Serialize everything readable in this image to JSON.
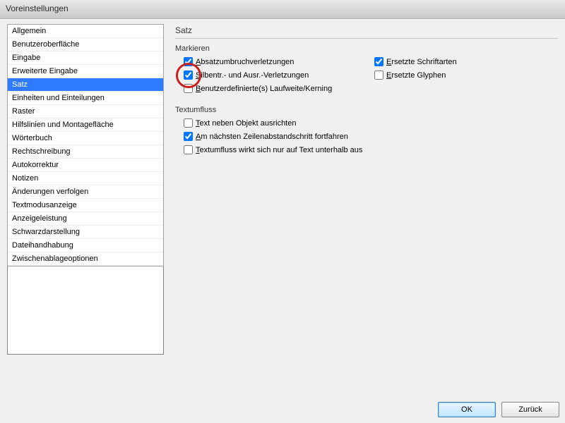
{
  "window": {
    "title": "Voreinstellungen"
  },
  "sidebar": {
    "items": [
      "Allgemein",
      "Benutzeroberfläche",
      "Eingabe",
      "Erweiterte Eingabe",
      "Satz",
      "Einheiten und Einteilungen",
      "Raster",
      "Hilfslinien und Montagefläche",
      "Wörterbuch",
      "Rechtschreibung",
      "Autokorrektur",
      "Notizen",
      "Änderungen verfolgen",
      "Textmodusanzeige",
      "Anzeigeleistung",
      "Schwarzdarstellung",
      "Dateihandhabung",
      "Zwischenablageoptionen"
    ],
    "selected_index": 4
  },
  "panel": {
    "title": "Satz",
    "groups": {
      "mark": {
        "title": "Markieren",
        "options": [
          {
            "label": "Absatzumbruchverletzungen",
            "checked": true
          },
          {
            "label": "Ersetzte Schriftarten",
            "checked": true
          },
          {
            "label": "Silbentr.- und Ausr.-Verletzungen",
            "checked": true
          },
          {
            "label": "Ersetzte Glyphen",
            "checked": false
          },
          {
            "label": "Benutzerdefinierte(s) Laufweite/Kerning",
            "checked": false
          }
        ]
      },
      "wrap": {
        "title": "Textumfluss",
        "options": [
          {
            "label": "Text neben Objekt ausrichten",
            "checked": false
          },
          {
            "label": "Am nächsten Zeilenabstandschritt fortfahren",
            "checked": true
          },
          {
            "label": "Textumfluss wirkt sich nur auf Text unterhalb aus",
            "checked": false
          }
        ]
      }
    }
  },
  "buttons": {
    "ok": "OK",
    "back": "Zurück"
  },
  "annotation": {
    "circle_option_index": 2
  }
}
